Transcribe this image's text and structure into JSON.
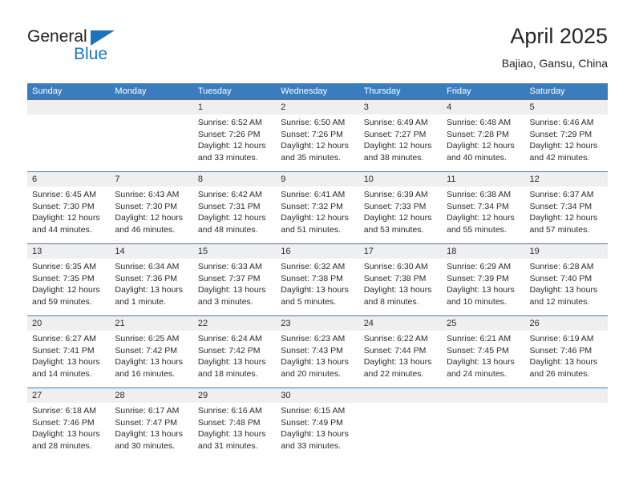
{
  "brand": {
    "name_top": "General",
    "name_bottom": "Blue",
    "accent_color": "#1c75bc"
  },
  "header": {
    "title": "April 2025",
    "subtitle": "Bajiao, Gansu, China"
  },
  "theme": {
    "header_blue": "#3a7cbe",
    "date_band_gray": "#efefef",
    "text_color": "#2a2a2a"
  },
  "weekdays": [
    "Sunday",
    "Monday",
    "Tuesday",
    "Wednesday",
    "Thursday",
    "Friday",
    "Saturday"
  ],
  "weeks": [
    [
      {
        "day": "",
        "lines": []
      },
      {
        "day": "",
        "lines": []
      },
      {
        "day": "1",
        "lines": [
          "Sunrise: 6:52 AM",
          "Sunset: 7:26 PM",
          "Daylight: 12 hours",
          "and 33 minutes."
        ]
      },
      {
        "day": "2",
        "lines": [
          "Sunrise: 6:50 AM",
          "Sunset: 7:26 PM",
          "Daylight: 12 hours",
          "and 35 minutes."
        ]
      },
      {
        "day": "3",
        "lines": [
          "Sunrise: 6:49 AM",
          "Sunset: 7:27 PM",
          "Daylight: 12 hours",
          "and 38 minutes."
        ]
      },
      {
        "day": "4",
        "lines": [
          "Sunrise: 6:48 AM",
          "Sunset: 7:28 PM",
          "Daylight: 12 hours",
          "and 40 minutes."
        ]
      },
      {
        "day": "5",
        "lines": [
          "Sunrise: 6:46 AM",
          "Sunset: 7:29 PM",
          "Daylight: 12 hours",
          "and 42 minutes."
        ]
      }
    ],
    [
      {
        "day": "6",
        "lines": [
          "Sunrise: 6:45 AM",
          "Sunset: 7:30 PM",
          "Daylight: 12 hours",
          "and 44 minutes."
        ]
      },
      {
        "day": "7",
        "lines": [
          "Sunrise: 6:43 AM",
          "Sunset: 7:30 PM",
          "Daylight: 12 hours",
          "and 46 minutes."
        ]
      },
      {
        "day": "8",
        "lines": [
          "Sunrise: 6:42 AM",
          "Sunset: 7:31 PM",
          "Daylight: 12 hours",
          "and 48 minutes."
        ]
      },
      {
        "day": "9",
        "lines": [
          "Sunrise: 6:41 AM",
          "Sunset: 7:32 PM",
          "Daylight: 12 hours",
          "and 51 minutes."
        ]
      },
      {
        "day": "10",
        "lines": [
          "Sunrise: 6:39 AM",
          "Sunset: 7:33 PM",
          "Daylight: 12 hours",
          "and 53 minutes."
        ]
      },
      {
        "day": "11",
        "lines": [
          "Sunrise: 6:38 AM",
          "Sunset: 7:34 PM",
          "Daylight: 12 hours",
          "and 55 minutes."
        ]
      },
      {
        "day": "12",
        "lines": [
          "Sunrise: 6:37 AM",
          "Sunset: 7:34 PM",
          "Daylight: 12 hours",
          "and 57 minutes."
        ]
      }
    ],
    [
      {
        "day": "13",
        "lines": [
          "Sunrise: 6:35 AM",
          "Sunset: 7:35 PM",
          "Daylight: 12 hours",
          "and 59 minutes."
        ]
      },
      {
        "day": "14",
        "lines": [
          "Sunrise: 6:34 AM",
          "Sunset: 7:36 PM",
          "Daylight: 13 hours",
          "and 1 minute."
        ]
      },
      {
        "day": "15",
        "lines": [
          "Sunrise: 6:33 AM",
          "Sunset: 7:37 PM",
          "Daylight: 13 hours",
          "and 3 minutes."
        ]
      },
      {
        "day": "16",
        "lines": [
          "Sunrise: 6:32 AM",
          "Sunset: 7:38 PM",
          "Daylight: 13 hours",
          "and 5 minutes."
        ]
      },
      {
        "day": "17",
        "lines": [
          "Sunrise: 6:30 AM",
          "Sunset: 7:38 PM",
          "Daylight: 13 hours",
          "and 8 minutes."
        ]
      },
      {
        "day": "18",
        "lines": [
          "Sunrise: 6:29 AM",
          "Sunset: 7:39 PM",
          "Daylight: 13 hours",
          "and 10 minutes."
        ]
      },
      {
        "day": "19",
        "lines": [
          "Sunrise: 6:28 AM",
          "Sunset: 7:40 PM",
          "Daylight: 13 hours",
          "and 12 minutes."
        ]
      }
    ],
    [
      {
        "day": "20",
        "lines": [
          "Sunrise: 6:27 AM",
          "Sunset: 7:41 PM",
          "Daylight: 13 hours",
          "and 14 minutes."
        ]
      },
      {
        "day": "21",
        "lines": [
          "Sunrise: 6:25 AM",
          "Sunset: 7:42 PM",
          "Daylight: 13 hours",
          "and 16 minutes."
        ]
      },
      {
        "day": "22",
        "lines": [
          "Sunrise: 6:24 AM",
          "Sunset: 7:42 PM",
          "Daylight: 13 hours",
          "and 18 minutes."
        ]
      },
      {
        "day": "23",
        "lines": [
          "Sunrise: 6:23 AM",
          "Sunset: 7:43 PM",
          "Daylight: 13 hours",
          "and 20 minutes."
        ]
      },
      {
        "day": "24",
        "lines": [
          "Sunrise: 6:22 AM",
          "Sunset: 7:44 PM",
          "Daylight: 13 hours",
          "and 22 minutes."
        ]
      },
      {
        "day": "25",
        "lines": [
          "Sunrise: 6:21 AM",
          "Sunset: 7:45 PM",
          "Daylight: 13 hours",
          "and 24 minutes."
        ]
      },
      {
        "day": "26",
        "lines": [
          "Sunrise: 6:19 AM",
          "Sunset: 7:46 PM",
          "Daylight: 13 hours",
          "and 26 minutes."
        ]
      }
    ],
    [
      {
        "day": "27",
        "lines": [
          "Sunrise: 6:18 AM",
          "Sunset: 7:46 PM",
          "Daylight: 13 hours",
          "and 28 minutes."
        ]
      },
      {
        "day": "28",
        "lines": [
          "Sunrise: 6:17 AM",
          "Sunset: 7:47 PM",
          "Daylight: 13 hours",
          "and 30 minutes."
        ]
      },
      {
        "day": "29",
        "lines": [
          "Sunrise: 6:16 AM",
          "Sunset: 7:48 PM",
          "Daylight: 13 hours",
          "and 31 minutes."
        ]
      },
      {
        "day": "30",
        "lines": [
          "Sunrise: 6:15 AM",
          "Sunset: 7:49 PM",
          "Daylight: 13 hours",
          "and 33 minutes."
        ]
      },
      {
        "day": "",
        "lines": []
      },
      {
        "day": "",
        "lines": []
      },
      {
        "day": "",
        "lines": []
      }
    ]
  ]
}
